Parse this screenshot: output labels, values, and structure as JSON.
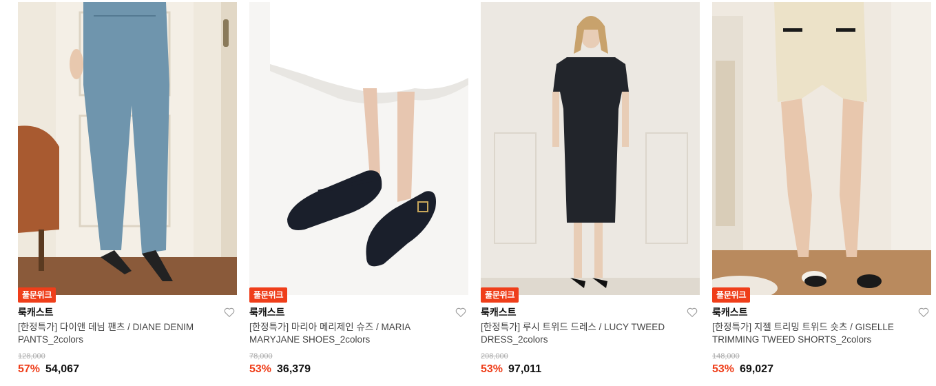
{
  "products": [
    {
      "badge": "풀문위크",
      "brand": "룩캐스트",
      "name": "[한정특가] 다이앤 데님 팬츠 / DIANE DENIM PANTS_2colors",
      "original_price": "128,000",
      "discount": "57%",
      "price": "54,067",
      "wishlist_icon": "heart-icon"
    },
    {
      "badge": "풀문위크",
      "brand": "룩캐스트",
      "name": "[한정특가] 마리아 메리제인 슈즈 / MARIA MARYJANE SHOES_2colors",
      "original_price": "78,000",
      "discount": "53%",
      "price": "36,379",
      "wishlist_icon": "heart-icon"
    },
    {
      "badge": "풀문위크",
      "brand": "룩캐스트",
      "name": "[한정특가] 루시 트위드 드레스 / LUCY TWEED DRESS_2colors",
      "original_price": "208,000",
      "discount": "53%",
      "price": "97,011",
      "wishlist_icon": "heart-icon"
    },
    {
      "badge": "풀문위크",
      "brand": "룩캐스트",
      "name": "[한정특가] 지젤 트리밍 트위드 숏츠 / GISELLE TRIMMING TWEED SHORTS_2colors",
      "original_price": "148,000",
      "discount": "53%",
      "price": "69,027",
      "wishlist_icon": "heart-icon"
    }
  ],
  "colors": {
    "accent": "#ef3e1a",
    "text": "#111111",
    "muted": "#aaaaaa"
  }
}
